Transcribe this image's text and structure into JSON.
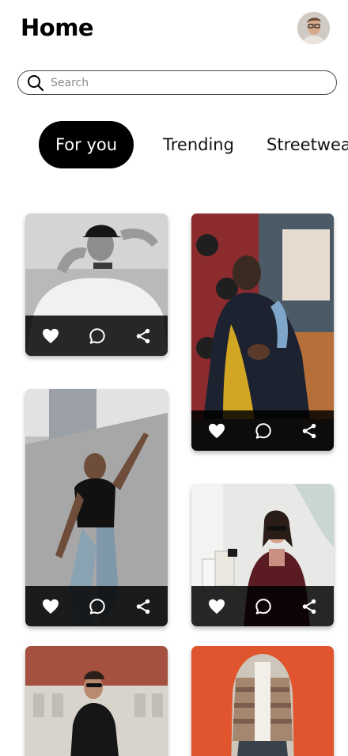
{
  "header": {
    "title": "Home"
  },
  "search": {
    "placeholder": "Search"
  },
  "tabs": [
    {
      "label": "For you",
      "active": true
    },
    {
      "label": "Trending",
      "active": false
    },
    {
      "label": "Streetwear",
      "active": false
    }
  ],
  "icons": {
    "search": "search-icon",
    "like": "heart-icon",
    "comment": "comment-icon",
    "share": "share-icon"
  },
  "colors": {
    "accent": "#000000",
    "active_tab_text": "#ffffff",
    "action_bar": "#000000",
    "icon": "#ffffff"
  }
}
